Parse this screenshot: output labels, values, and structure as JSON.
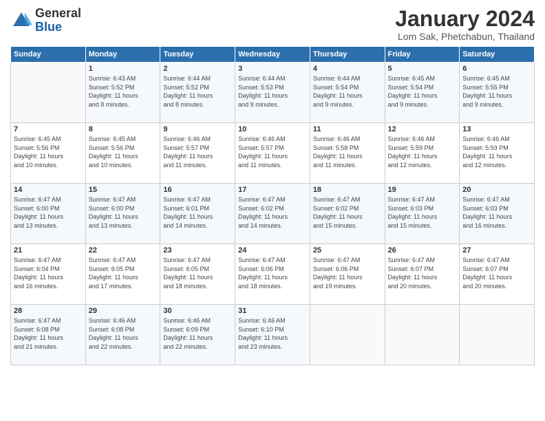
{
  "header": {
    "logo_general": "General",
    "logo_blue": "Blue",
    "month_title": "January 2024",
    "location": "Lom Sak, Phetchabun, Thailand"
  },
  "days_of_week": [
    "Sunday",
    "Monday",
    "Tuesday",
    "Wednesday",
    "Thursday",
    "Friday",
    "Saturday"
  ],
  "weeks": [
    [
      {
        "day": "",
        "info": ""
      },
      {
        "day": "1",
        "info": "Sunrise: 6:43 AM\nSunset: 5:52 PM\nDaylight: 11 hours\nand 8 minutes."
      },
      {
        "day": "2",
        "info": "Sunrise: 6:44 AM\nSunset: 5:52 PM\nDaylight: 11 hours\nand 8 minutes."
      },
      {
        "day": "3",
        "info": "Sunrise: 6:44 AM\nSunset: 5:53 PM\nDaylight: 11 hours\nand 9 minutes."
      },
      {
        "day": "4",
        "info": "Sunrise: 6:44 AM\nSunset: 5:54 PM\nDaylight: 11 hours\nand 9 minutes."
      },
      {
        "day": "5",
        "info": "Sunrise: 6:45 AM\nSunset: 5:54 PM\nDaylight: 11 hours\nand 9 minutes."
      },
      {
        "day": "6",
        "info": "Sunrise: 6:45 AM\nSunset: 5:55 PM\nDaylight: 11 hours\nand 9 minutes."
      }
    ],
    [
      {
        "day": "7",
        "info": "Sunrise: 6:45 AM\nSunset: 5:56 PM\nDaylight: 11 hours\nand 10 minutes."
      },
      {
        "day": "8",
        "info": "Sunrise: 6:45 AM\nSunset: 5:56 PM\nDaylight: 11 hours\nand 10 minutes."
      },
      {
        "day": "9",
        "info": "Sunrise: 6:46 AM\nSunset: 5:57 PM\nDaylight: 11 hours\nand 11 minutes."
      },
      {
        "day": "10",
        "info": "Sunrise: 6:46 AM\nSunset: 5:57 PM\nDaylight: 11 hours\nand 11 minutes."
      },
      {
        "day": "11",
        "info": "Sunrise: 6:46 AM\nSunset: 5:58 PM\nDaylight: 11 hours\nand 11 minutes."
      },
      {
        "day": "12",
        "info": "Sunrise: 6:46 AM\nSunset: 5:59 PM\nDaylight: 11 hours\nand 12 minutes."
      },
      {
        "day": "13",
        "info": "Sunrise: 6:46 AM\nSunset: 5:59 PM\nDaylight: 11 hours\nand 12 minutes."
      }
    ],
    [
      {
        "day": "14",
        "info": "Sunrise: 6:47 AM\nSunset: 6:00 PM\nDaylight: 11 hours\nand 13 minutes."
      },
      {
        "day": "15",
        "info": "Sunrise: 6:47 AM\nSunset: 6:00 PM\nDaylight: 11 hours\nand 13 minutes."
      },
      {
        "day": "16",
        "info": "Sunrise: 6:47 AM\nSunset: 6:01 PM\nDaylight: 11 hours\nand 14 minutes."
      },
      {
        "day": "17",
        "info": "Sunrise: 6:47 AM\nSunset: 6:02 PM\nDaylight: 11 hours\nand 14 minutes."
      },
      {
        "day": "18",
        "info": "Sunrise: 6:47 AM\nSunset: 6:02 PM\nDaylight: 11 hours\nand 15 minutes."
      },
      {
        "day": "19",
        "info": "Sunrise: 6:47 AM\nSunset: 6:03 PM\nDaylight: 11 hours\nand 15 minutes."
      },
      {
        "day": "20",
        "info": "Sunrise: 6:47 AM\nSunset: 6:03 PM\nDaylight: 11 hours\nand 16 minutes."
      }
    ],
    [
      {
        "day": "21",
        "info": "Sunrise: 6:47 AM\nSunset: 6:04 PM\nDaylight: 11 hours\nand 16 minutes."
      },
      {
        "day": "22",
        "info": "Sunrise: 6:47 AM\nSunset: 6:05 PM\nDaylight: 11 hours\nand 17 minutes."
      },
      {
        "day": "23",
        "info": "Sunrise: 6:47 AM\nSunset: 6:05 PM\nDaylight: 11 hours\nand 18 minutes."
      },
      {
        "day": "24",
        "info": "Sunrise: 6:47 AM\nSunset: 6:06 PM\nDaylight: 11 hours\nand 18 minutes."
      },
      {
        "day": "25",
        "info": "Sunrise: 6:47 AM\nSunset: 6:06 PM\nDaylight: 11 hours\nand 19 minutes."
      },
      {
        "day": "26",
        "info": "Sunrise: 6:47 AM\nSunset: 6:07 PM\nDaylight: 11 hours\nand 20 minutes."
      },
      {
        "day": "27",
        "info": "Sunrise: 6:47 AM\nSunset: 6:07 PM\nDaylight: 11 hours\nand 20 minutes."
      }
    ],
    [
      {
        "day": "28",
        "info": "Sunrise: 6:47 AM\nSunset: 6:08 PM\nDaylight: 11 hours\nand 21 minutes."
      },
      {
        "day": "29",
        "info": "Sunrise: 6:46 AM\nSunset: 6:08 PM\nDaylight: 11 hours\nand 22 minutes."
      },
      {
        "day": "30",
        "info": "Sunrise: 6:46 AM\nSunset: 6:09 PM\nDaylight: 11 hours\nand 22 minutes."
      },
      {
        "day": "31",
        "info": "Sunrise: 6:46 AM\nSunset: 6:10 PM\nDaylight: 11 hours\nand 23 minutes."
      },
      {
        "day": "",
        "info": ""
      },
      {
        "day": "",
        "info": ""
      },
      {
        "day": "",
        "info": ""
      }
    ]
  ]
}
